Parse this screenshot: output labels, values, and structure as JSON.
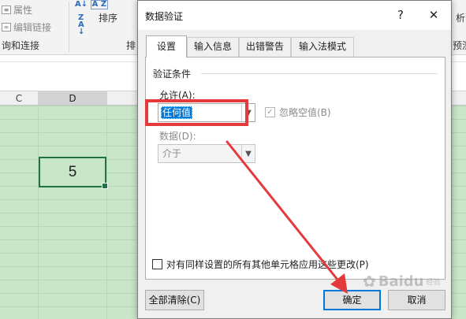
{
  "excel": {
    "ribbon": {
      "properties": "属性",
      "edit_links": "编辑链接",
      "group_queries": "询和连接",
      "sort": "排序",
      "group_sort_trunc": "排",
      "right_trunc_1": "析",
      "right_trunc_2": "预测"
    },
    "columns": [
      "C",
      "D"
    ],
    "cell_value": "5"
  },
  "dialog": {
    "title": "数据验证",
    "help": "?",
    "close": "✕",
    "tabs": [
      "设置",
      "输入信息",
      "出错警告",
      "输入法模式"
    ],
    "active_tab": "设置",
    "group_label": "验证条件",
    "allow_label": "允许(A):",
    "allow_value": "任何值",
    "ignore_blank": "忽略空值(B)",
    "ignore_blank_checked": true,
    "data_label": "数据(D):",
    "data_value": "介于",
    "apply_all": "对有同样设置的所有其他单元格应用这些更改(P)",
    "clear_all": "全部清除(C)",
    "ok": "确定",
    "cancel": "取消"
  },
  "watermark": {
    "text": "Baidu",
    "sub": "经验"
  },
  "colors": {
    "highlight_red": "#e53a3a",
    "grid_green": "#c9e6c9",
    "select_blue": "#0078d7"
  }
}
